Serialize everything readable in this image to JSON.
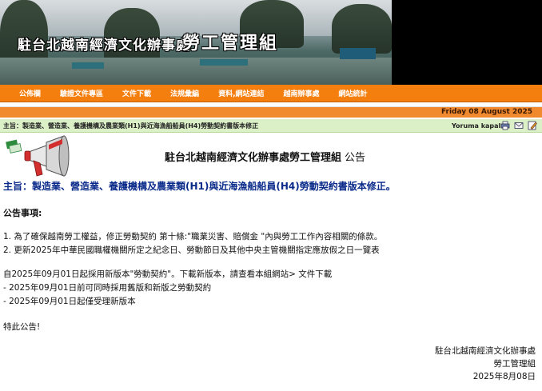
{
  "banner": {
    "office_name": "駐台北越南經濟文化辦事處",
    "group_name": "勞工管理組"
  },
  "nav": {
    "items": [
      "公佈欄",
      "驗證文件專區",
      "文件下載",
      "法規彙編",
      "資料,網站連結",
      "越南辦事處",
      "網站統計"
    ]
  },
  "datebar": {
    "date": "Friday 08 August 2025"
  },
  "subjectbar": {
    "subject": "主旨：製造業、營造業、養護機構及農業類(H1)與近海漁船船員(H4)勞動契約書版本修正",
    "language": "Yoruma kapalı",
    "tool_icons": [
      "print-icon",
      "email-icon",
      "edit-icon"
    ]
  },
  "notice": {
    "heading": "駐台北越南經濟文化辦事處勞工管理組",
    "heading_suffix": "公告",
    "subject": "主旨：製造業、營造業、養護機構及農業類(H1)與近海漁船船員(H4)勞動契約書版本修正。",
    "announce_label": "公告事項:",
    "items": [
      "1. 為了確保越南勞工權益，修正勞動契約 第十條:\"職業災害、賠償金 \"內與勞工工作內容相關的條款。",
      "2. 更新2025年中華民國職權機關所定之紀念日、勞動節日及其他中央主管機關指定應放假之日一覽表"
    ],
    "adoption": [
      "自2025年09月01日起採用新版本\"勞動契約\"。下載新版本，請查看本組網站> 文件下載",
      "- 2025年09月01日前可同時採用舊版和新版之勞動契約",
      "- 2025年09月01日起僅受理新版本"
    ],
    "closing": "特此公告!",
    "signature": [
      "駐台北越南經濟文化辦事處",
      "勞工管理組",
      "2025年8月08日"
    ]
  },
  "colors": {
    "nav_bg": "#f57f0e",
    "subject_bar_bg": "#dcf0c8",
    "subject_text": "#0a2a8a"
  }
}
